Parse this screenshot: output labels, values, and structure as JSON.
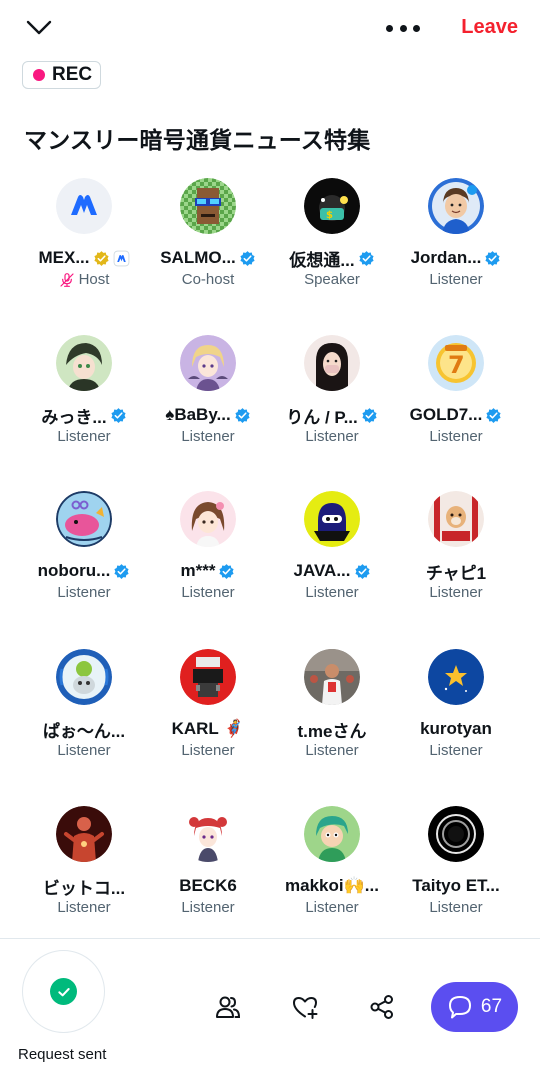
{
  "header": {
    "leave_label": "Leave"
  },
  "recording": {
    "label": "REC"
  },
  "space": {
    "title": "マンスリー暗号通貨ニュース特集"
  },
  "participants": [
    {
      "name": "MEX...",
      "role": "Host",
      "verified": "gold",
      "extra_badge": "mexc",
      "muted": true
    },
    {
      "name": "SALMO...",
      "role": "Co-host",
      "verified": "blue"
    },
    {
      "name": "仮想通...",
      "role": "Speaker",
      "verified": "blue"
    },
    {
      "name": "Jordan...",
      "role": "Listener",
      "verified": "blue"
    },
    {
      "name": "みっき...",
      "role": "Listener",
      "verified": "blue"
    },
    {
      "name": "♠BaBy...",
      "role": "Listener",
      "verified": "blue"
    },
    {
      "name": "りん / P...",
      "role": "Listener",
      "verified": "blue"
    },
    {
      "name": "GOLD7...",
      "role": "Listener",
      "verified": "blue"
    },
    {
      "name": "noboru...",
      "role": "Listener",
      "verified": "blue"
    },
    {
      "name": "m***",
      "role": "Listener",
      "verified": "blue"
    },
    {
      "name": "JAVA...",
      "role": "Listener",
      "verified": "blue"
    },
    {
      "name": "チャピ1",
      "role": "Listener",
      "verified": "none"
    },
    {
      "name": "ぱぉ～ん...",
      "role": "Listener",
      "verified": "none"
    },
    {
      "name": "KARL 🦸",
      "role": "Listener",
      "verified": "none"
    },
    {
      "name": "t.meさん",
      "role": "Listener",
      "verified": "none"
    },
    {
      "name": "kurotyan",
      "role": "Listener",
      "verified": "none"
    },
    {
      "name": "ビットコ...",
      "role": "Listener",
      "verified": "none"
    },
    {
      "name": "BECK6",
      "role": "Listener",
      "verified": "none"
    },
    {
      "name": "makkoi🙌...",
      "role": "Listener",
      "verified": "none"
    },
    {
      "name": "Taityo ET...",
      "role": "Listener",
      "verified": "none"
    }
  ],
  "footer": {
    "request_label": "Request sent",
    "chat_count": "67"
  },
  "colors": {
    "leave": "#f4212e",
    "rec_dot": "#f91880",
    "verified_blue": "#1d9bf0",
    "verified_gold": "#e2b719",
    "request_check": "#00ba7c",
    "chat_button": "#5b4ef0"
  }
}
